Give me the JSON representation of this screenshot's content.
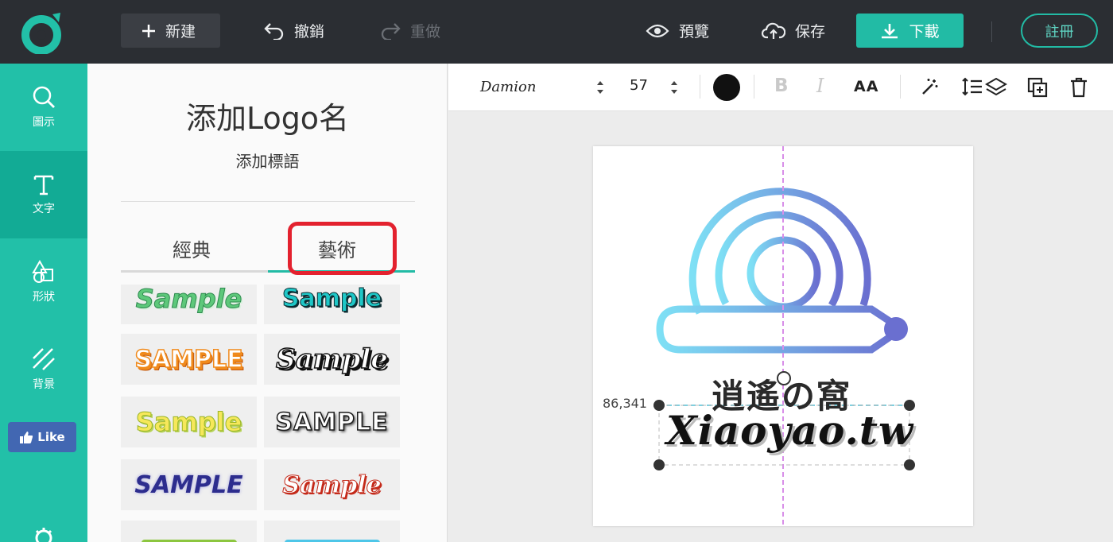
{
  "topbar": {
    "new_label": "新建",
    "undo_label": "撤銷",
    "redo_label": "重做",
    "preview_label": "預覽",
    "save_label": "保存",
    "download_label": "下載",
    "register_label": "註冊"
  },
  "nav": {
    "items": [
      {
        "label": "圖示",
        "icon": "search-icon"
      },
      {
        "label": "文字",
        "icon": "text-icon"
      },
      {
        "label": "形狀",
        "icon": "shapes-icon"
      },
      {
        "label": "背景",
        "icon": "background-icon"
      }
    ],
    "like_label": "Like"
  },
  "panel": {
    "title": "添加Logo名",
    "subtitle": "添加標語",
    "tabs": [
      "經典",
      "藝術"
    ],
    "active_tab": "藝術",
    "samples": [
      "Sample",
      "Sample",
      "SAMPLE",
      "Sample",
      "Sample",
      "SAMPLE",
      "SAMPLE",
      "Sample"
    ]
  },
  "toolbar": {
    "font_name": "Damion",
    "font_size": "57",
    "bold_label": "B",
    "italic_label": "I",
    "case_label": "AA",
    "text_color": "#111111"
  },
  "canvas": {
    "brand_name": "逍遙の窩",
    "brand_url": "Xiaoyao.tw",
    "coordinate_label": "86,341"
  },
  "colors": {
    "accent": "#22bba5",
    "highlight": "#e3212e",
    "logo_gradient_start": "#7ee0f5",
    "logo_gradient_end": "#6a6fd0"
  }
}
